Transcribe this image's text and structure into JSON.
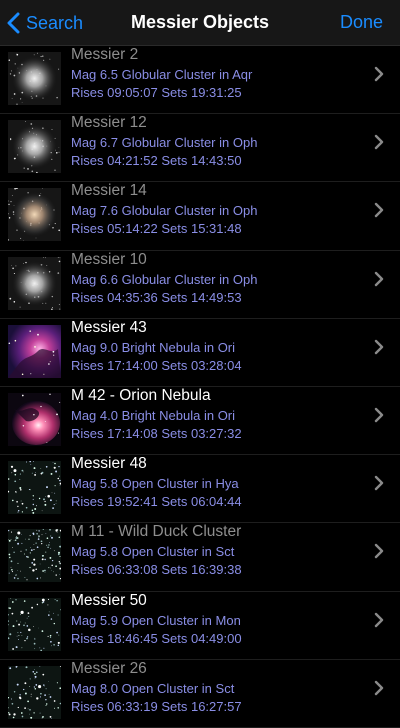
{
  "nav": {
    "back_label": "Search",
    "title": "Messier Objects",
    "done_label": "Done"
  },
  "objects": [
    {
      "name": "Messier 2",
      "desc": "Mag 6.5 Globular Cluster in Aqr",
      "times": "Rises 09:05:07  Sets 19:31:25",
      "visible": false,
      "thumb": "globular"
    },
    {
      "name": "Messier 12",
      "desc": "Mag 6.7 Globular Cluster in Oph",
      "times": "Rises 04:21:52  Sets 14:43:50",
      "visible": false,
      "thumb": "globular"
    },
    {
      "name": "Messier 14",
      "desc": "Mag 7.6 Globular Cluster in Oph",
      "times": "Rises 05:14:22  Sets 15:31:48",
      "visible": false,
      "thumb": "globular-warm"
    },
    {
      "name": "Messier 10",
      "desc": "Mag 6.6 Globular Cluster in Oph",
      "times": "Rises 04:35:36  Sets 14:49:53",
      "visible": false,
      "thumb": "globular"
    },
    {
      "name": "Messier 43",
      "desc": "Mag 9.0 Bright Nebula in Ori",
      "times": "Rises 17:14:00  Sets 03:28:04",
      "visible": true,
      "thumb": "nebula-43"
    },
    {
      "name": "M 42 - Orion Nebula",
      "desc": "Mag 4.0 Bright Nebula in Ori",
      "times": "Rises 17:14:08  Sets 03:27:32",
      "visible": true,
      "thumb": "nebula-42"
    },
    {
      "name": "Messier 48",
      "desc": "Mag 5.8 Open Cluster in Hya",
      "times": "Rises 19:52:41  Sets 06:04:44",
      "visible": true,
      "thumb": "open"
    },
    {
      "name": "M 11 - Wild Duck Cluster",
      "desc": "Mag 5.8 Open Cluster in Sct",
      "times": "Rises 06:33:08  Sets 16:39:38",
      "visible": false,
      "thumb": "open-dense"
    },
    {
      "name": "Messier 50",
      "desc": "Mag 5.9 Open Cluster in Mon",
      "times": "Rises 18:46:45  Sets 04:49:00",
      "visible": true,
      "thumb": "open"
    },
    {
      "name": "Messier 26",
      "desc": "Mag 8.0 Open Cluster in Sct",
      "times": "Rises 06:33:19  Sets 16:27:57",
      "visible": false,
      "thumb": "open"
    }
  ],
  "colors": {
    "accent": "#1a8cff",
    "detail_text": "#8a8ee6",
    "visible_name": "#ffffff",
    "hidden_name": "#8e8e8e"
  },
  "icons": {
    "back": "chevron-left-icon",
    "row": "chevron-right-icon"
  }
}
